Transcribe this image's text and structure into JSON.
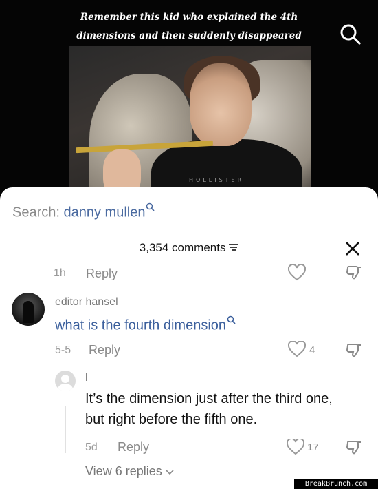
{
  "video": {
    "caption_line1": "Remember this kid who explained the 4th",
    "caption_line2": "dimensions and then suddenly disappeared",
    "shirt_text": "HOLLISTER"
  },
  "search": {
    "label": "Search:",
    "query": "danny mullen"
  },
  "comments_header": {
    "count": "3,354 comments"
  },
  "prev_comment": {
    "time": "1h",
    "reply_label": "Reply"
  },
  "comment1": {
    "username": "editor hansel",
    "text": "what is the fourth dimension",
    "date": "5-5",
    "reply_label": "Reply",
    "likes": "4"
  },
  "comment2": {
    "username": "l",
    "text_line1": "It’s the dimension just after the third one,",
    "text_line2": "but right before the fifth one.",
    "date": "5d",
    "reply_label": "Reply",
    "likes": "17"
  },
  "view_replies": "View 6 replies",
  "watermark": "BreakBrunch.com",
  "colors": {
    "link_blue": "#3b5f9c",
    "gray_text": "#8a8a8a"
  }
}
